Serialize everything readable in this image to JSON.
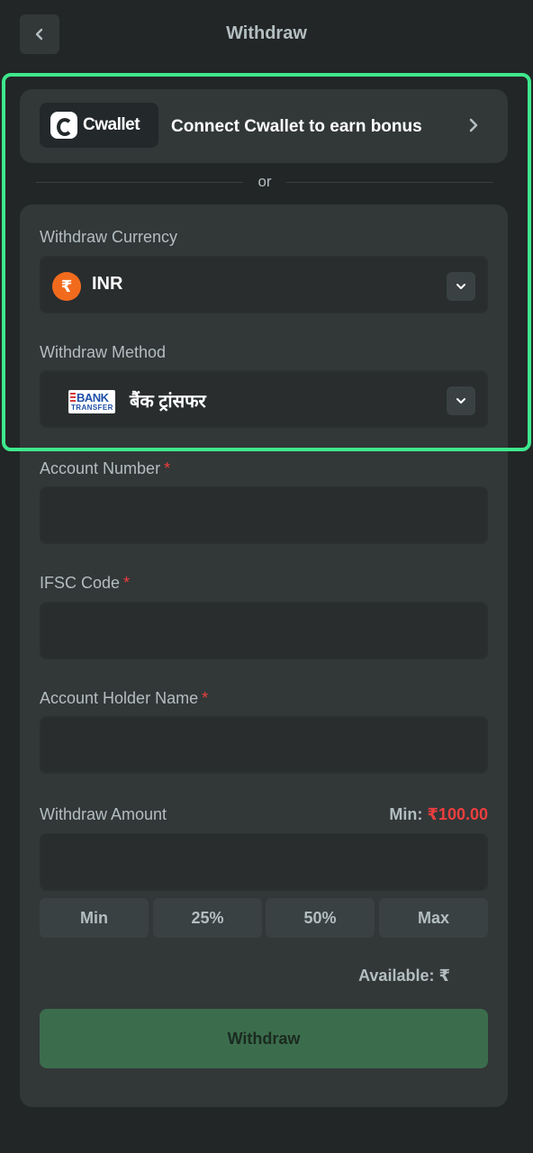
{
  "header": {
    "title": "Withdraw"
  },
  "cwallet": {
    "brand": "Cwallet",
    "text": "Connect Cwallet to earn bonus"
  },
  "divider": {
    "text": "or"
  },
  "currency": {
    "label": "Withdraw Currency",
    "value": "INR",
    "symbol": "₹"
  },
  "method": {
    "label": "Withdraw Method",
    "value": "बैंक ट्रांसफर",
    "logo_line1": "BANK",
    "logo_line2": "TRANSFER"
  },
  "fields": {
    "account_number": {
      "label": "Account Number",
      "required": "*",
      "value": ""
    },
    "ifsc": {
      "label": "IFSC Code",
      "required": "*",
      "value": ""
    },
    "holder_name": {
      "label": "Account Holder Name",
      "required": "*",
      "value": ""
    }
  },
  "amount": {
    "label": "Withdraw Amount",
    "min_label": "Min:",
    "min_value": "₹100.00",
    "value": "",
    "quick_buttons": [
      "Min",
      "25%",
      "50%",
      "Max"
    ]
  },
  "available": {
    "label": "Available: ₹"
  },
  "submit": {
    "label": "Withdraw"
  },
  "colors": {
    "accent": "#3ee88d",
    "required": "#ed3e3e",
    "button": "#3b6d4c",
    "card": "#323738"
  }
}
